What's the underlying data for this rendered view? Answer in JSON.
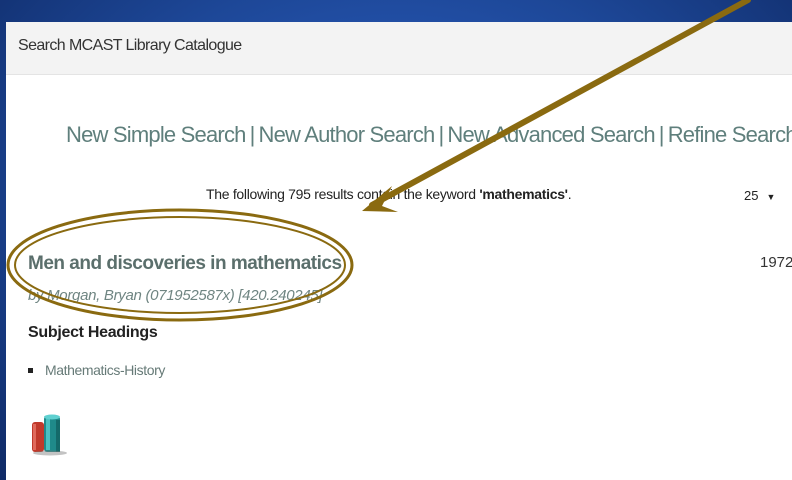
{
  "panel": {
    "title": "Search MCAST Library Catalogue"
  },
  "nav": {
    "links": [
      "New Simple Search",
      "New Author Search",
      "New Advanced Search",
      "Refine Search"
    ],
    "separator": "|"
  },
  "results": {
    "summary_prefix": "The following 795 results contain the keyword ",
    "keyword": "'mathematics'",
    "summary_suffix": ".",
    "per_page": "25"
  },
  "record": {
    "title": "Men and discoveries in mathematics",
    "year": "1972",
    "author_line": "by  Morgan, Bryan   (071952587x)   [420.240245]",
    "subject_heading_label": "Subject Headings",
    "subjects": [
      "Mathematics-History"
    ],
    "material_icon": "books-icon"
  },
  "annotation": {
    "color": "#8a6a10"
  }
}
